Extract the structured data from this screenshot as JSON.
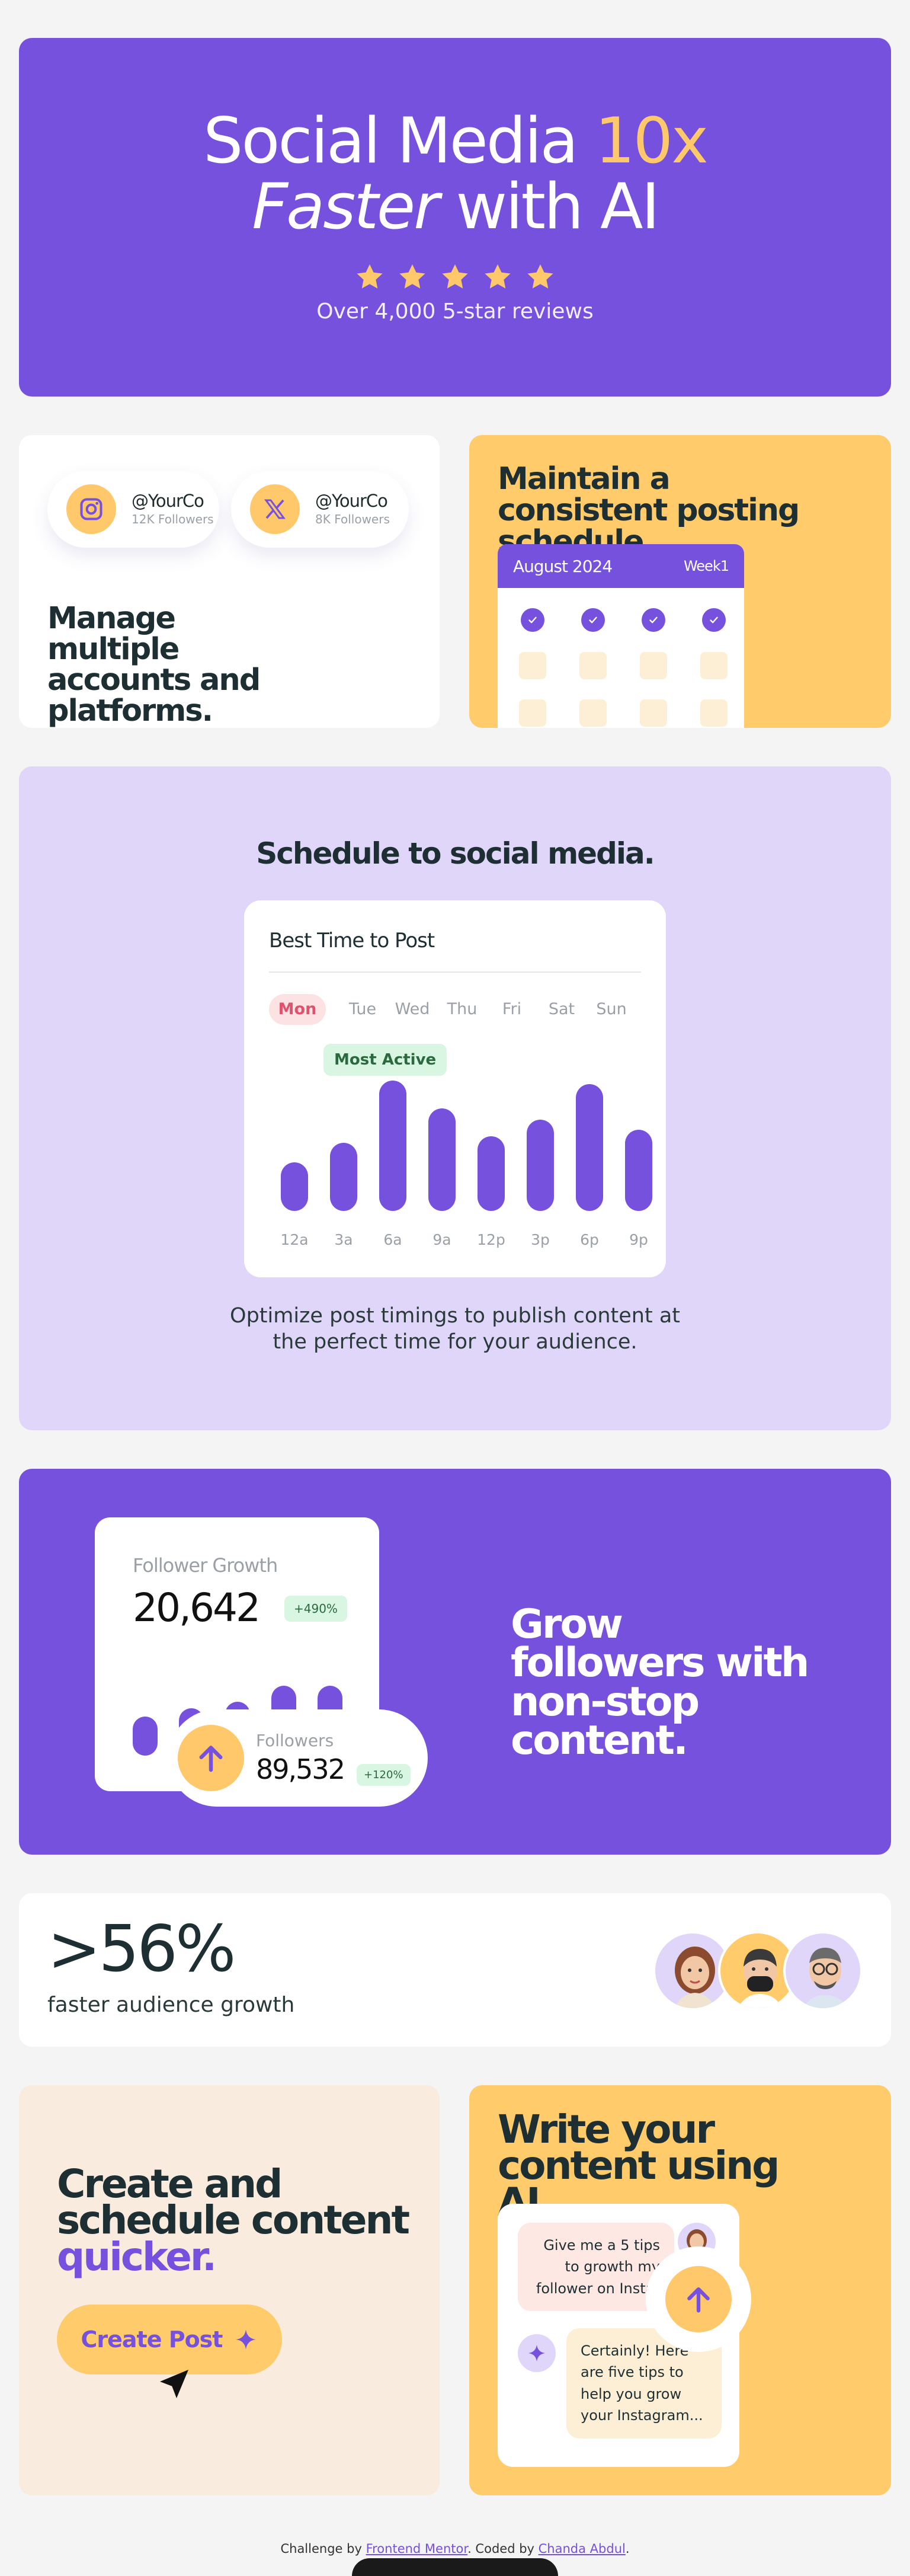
{
  "hero": {
    "title_part1": "Social Media ",
    "title_accent": "10x",
    "title_italic": "Faster",
    "title_part2": " with AI",
    "rating_stars": 5,
    "reviews": "Over 4,000 5-star reviews"
  },
  "accounts": {
    "items": [
      {
        "handle": "@YourCo",
        "followers": "12K Followers",
        "icon": "instagram-icon"
      },
      {
        "handle": "@YourCo",
        "followers": "8K Followers",
        "icon": "x-logo-icon"
      }
    ],
    "heading": "Manage multiple accounts and platforms."
  },
  "maintain": {
    "heading": "Maintain a consistent posting schedule.",
    "calendar": {
      "month": "August 2024",
      "week": "Week1",
      "checked_days": 4
    }
  },
  "schedule": {
    "heading": "Schedule to social media.",
    "card_title": "Best Time to Post",
    "days": [
      "Mon",
      "Tue",
      "Wed",
      "Thu",
      "Fri",
      "Sat",
      "Sun"
    ],
    "active_day": "Mon",
    "badge": "Most Active",
    "description": "Optimize post timings to publish content at the perfect time for your audience."
  },
  "chart_data": [
    {
      "type": "bar",
      "title": "Best Time to Post",
      "categories": [
        "12a",
        "3a",
        "6a",
        "9a",
        "12p",
        "3p",
        "6p",
        "9p"
      ],
      "values": [
        3,
        4.2,
        8,
        6.3,
        4.6,
        5.6,
        7.8,
        5
      ],
      "annotation": "Most Active"
    },
    {
      "type": "bar",
      "title": "Follower Growth",
      "values": [
        3.5,
        4.2,
        4.8,
        6.2,
        6.2
      ]
    }
  ],
  "grow": {
    "card_caption": "Follower Growth",
    "card_value": "20,642",
    "card_change": "+490%",
    "pill_caption": "Followers",
    "pill_value": "89,532",
    "pill_change": "+120%",
    "heading": "Grow followers with non-stop content."
  },
  "stats": {
    "value": ">56%",
    "label": "faster audience growth",
    "avatars": [
      "avatar-woman",
      "avatar-bearded-man",
      "avatar-glasses-man"
    ]
  },
  "create": {
    "heading_part1": "Create and schedule content ",
    "heading_accent": "quicker.",
    "button": "Create Post"
  },
  "write": {
    "heading": "Write your content using AI.",
    "user_message": "Give me a 5 tips to growth my follower on Insta!",
    "ai_message": "Certainly! Here are five tips to help you grow your Instagram..."
  },
  "footer": {
    "prefix": "Challenge by ",
    "link1": "Frontend Mentor",
    "middle": ". Coded by ",
    "link2": "Chanda Abdul",
    "suffix": "."
  },
  "colors": {
    "purple": "#7551DD",
    "yellow": "#FFCB6B",
    "lavender": "#E0D6FA",
    "cream": "#F9ECDF",
    "dark_text": "#1E2F33"
  }
}
